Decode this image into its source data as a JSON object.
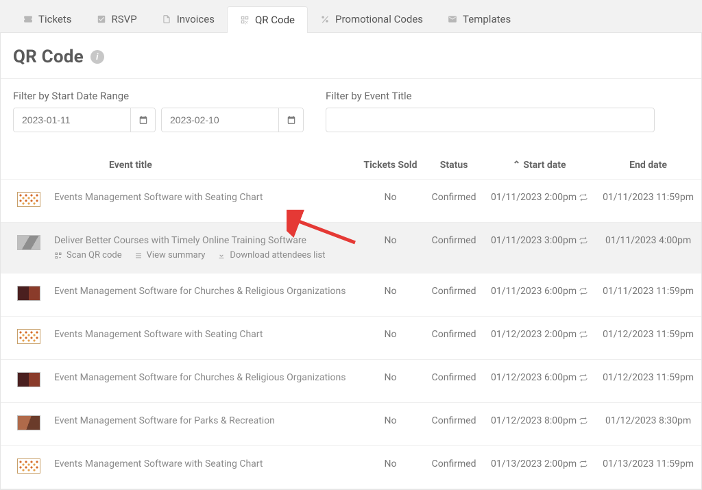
{
  "tabs": [
    {
      "label": "Tickets"
    },
    {
      "label": "RSVP"
    },
    {
      "label": "Invoices"
    },
    {
      "label": "QR Code"
    },
    {
      "label": "Promotional Codes"
    },
    {
      "label": "Templates"
    }
  ],
  "active_tab_index": 3,
  "page_title": "QR Code",
  "filters": {
    "date_label": "Filter by Start Date Range",
    "start_date": "2023-01-11",
    "end_date": "2023-02-10",
    "title_label": "Filter by Event Title",
    "title_value": ""
  },
  "table": {
    "headers": {
      "title": "Event title",
      "sold": "Tickets Sold",
      "status": "Status",
      "start": "Start date",
      "end": "End date"
    },
    "sort_col": "start",
    "rows": [
      {
        "title": "Events Management Software with Seating Chart",
        "sold": "No",
        "status": "Confirmed",
        "start": "01/11/2023 2:00pm",
        "end": "01/11/2023 11:59pm",
        "thumb": "t-orange",
        "recurring": true
      },
      {
        "title": "Deliver Better Courses with Timely Online Training Software",
        "sold": "No",
        "status": "Confirmed",
        "start": "01/11/2023 3:00pm",
        "end": "01/11/2023 4:00pm",
        "thumb": "t-photo",
        "recurring": true,
        "highlight": true,
        "actions": {
          "scan": "Scan QR code",
          "summary": "View summary",
          "download": "Download attendees list"
        }
      },
      {
        "title": "Event Management Software for Churches & Religious Organizations",
        "sold": "No",
        "status": "Confirmed",
        "start": "01/11/2023 6:00pm",
        "end": "01/11/2023 11:59pm",
        "thumb": "t-dark",
        "recurring": true
      },
      {
        "title": "Events Management Software with Seating Chart",
        "sold": "No",
        "status": "Confirmed",
        "start": "01/12/2023 2:00pm",
        "end": "01/12/2023 11:59pm",
        "thumb": "t-orange",
        "recurring": true
      },
      {
        "title": "Event Management Software for Churches & Religious Organizations",
        "sold": "No",
        "status": "Confirmed",
        "start": "01/12/2023 6:00pm",
        "end": "01/12/2023 11:59pm",
        "thumb": "t-dark",
        "recurring": true
      },
      {
        "title": "Event Management Software for Parks & Recreation",
        "sold": "No",
        "status": "Confirmed",
        "start": "01/12/2023 8:00pm",
        "end": "01/12/2023 8:30pm",
        "thumb": "t-people",
        "recurring": true
      },
      {
        "title": "Events Management Software with Seating Chart",
        "sold": "No",
        "status": "Confirmed",
        "start": "01/13/2023 2:00pm",
        "end": "01/13/2023 11:59pm",
        "thumb": "t-orange",
        "recurring": true
      }
    ]
  }
}
